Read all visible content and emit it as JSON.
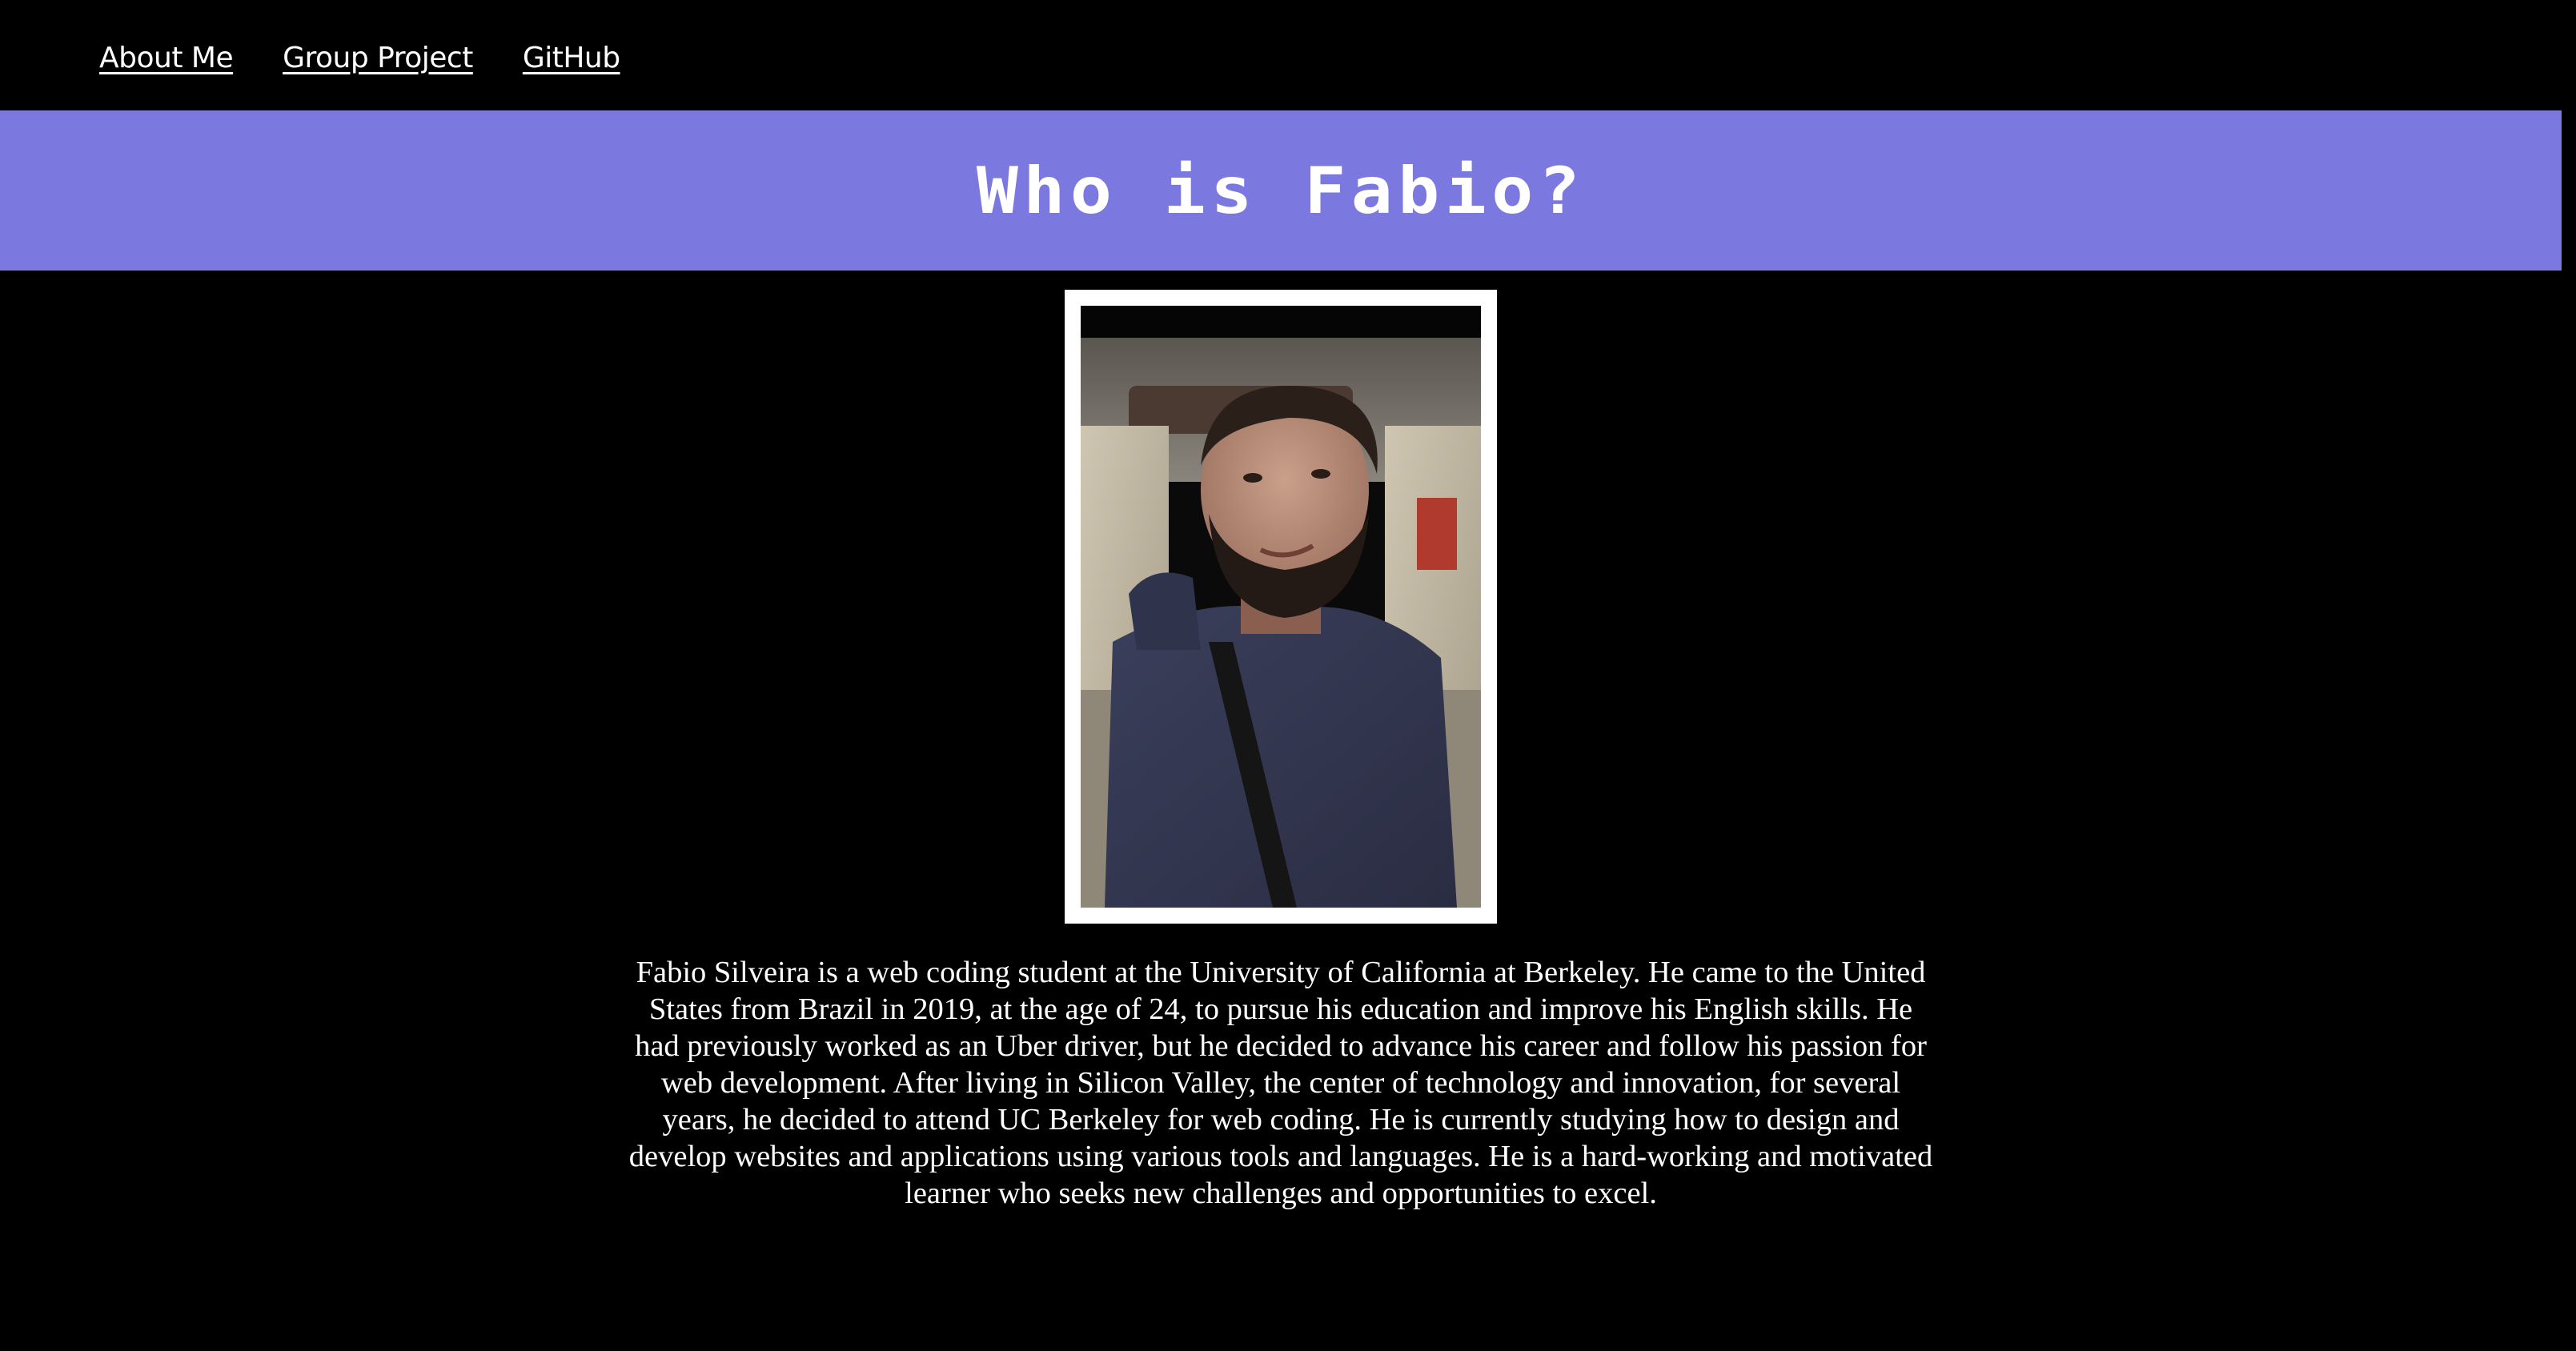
{
  "nav": {
    "items": [
      {
        "label": "About Me"
      },
      {
        "label": "Group Project"
      },
      {
        "label": "GitHub"
      }
    ]
  },
  "header": {
    "title": "Who is Fabio?"
  },
  "profile": {
    "photo_icon": "portrait-photo"
  },
  "bio": {
    "text": "Fabio Silveira is a web coding student at the University of California at Berkeley. He came to the United States from Brazil in 2019, at the age of 24, to pursue his education and improve his English skills. He had previously worked as an Uber driver, but he decided to advance his career and follow his passion for web development. After living in Silicon Valley, the center of technology and innovation, for several years, he decided to attend UC Berkeley for web coding. He is currently studying how to design and develop websites and applications using various tools and languages. He is a hard-working and motivated learner who seeks new challenges and opportunities to excel."
  },
  "colors": {
    "background": "#000000",
    "banner": "#7b79e0",
    "text": "#ffffff",
    "frame": "#ffffff"
  }
}
